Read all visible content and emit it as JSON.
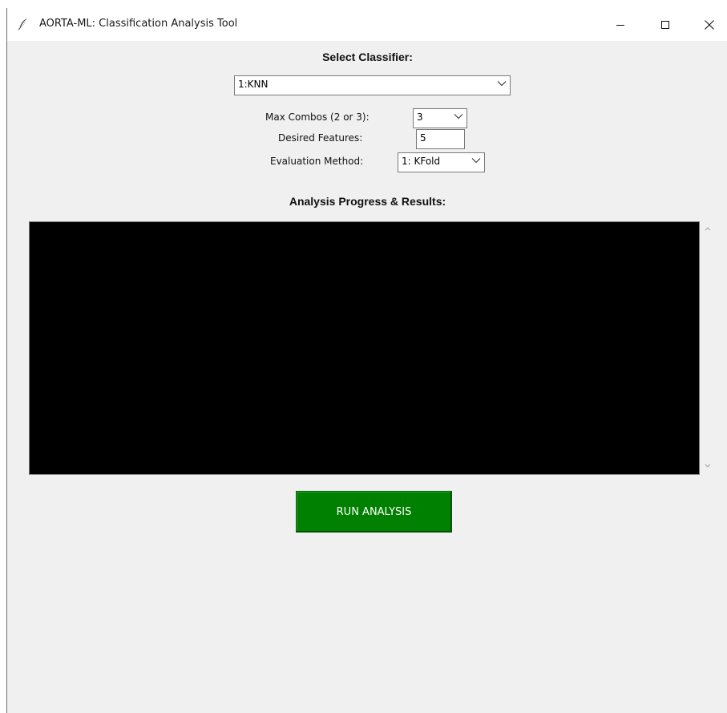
{
  "window": {
    "title": "AORTA-ML: Classification Analysis Tool",
    "icon": "feather-icon"
  },
  "classifier": {
    "heading": "Select Classifier:",
    "selected": "1:KNN"
  },
  "options": {
    "max_combos_label": "Max Combos (2 or 3):",
    "max_combos_value": "3",
    "desired_features_label": "Desired Features:",
    "desired_features_value": "5",
    "evaluation_label": "Evaluation Method:",
    "evaluation_value": "1: KFold"
  },
  "results": {
    "heading": "Analysis Progress & Results:",
    "content": ""
  },
  "actions": {
    "run_label": "RUN ANALYSIS"
  },
  "colors": {
    "run_button": "#008000",
    "results_background": "#000000",
    "window_background": "#f0f0f0"
  }
}
